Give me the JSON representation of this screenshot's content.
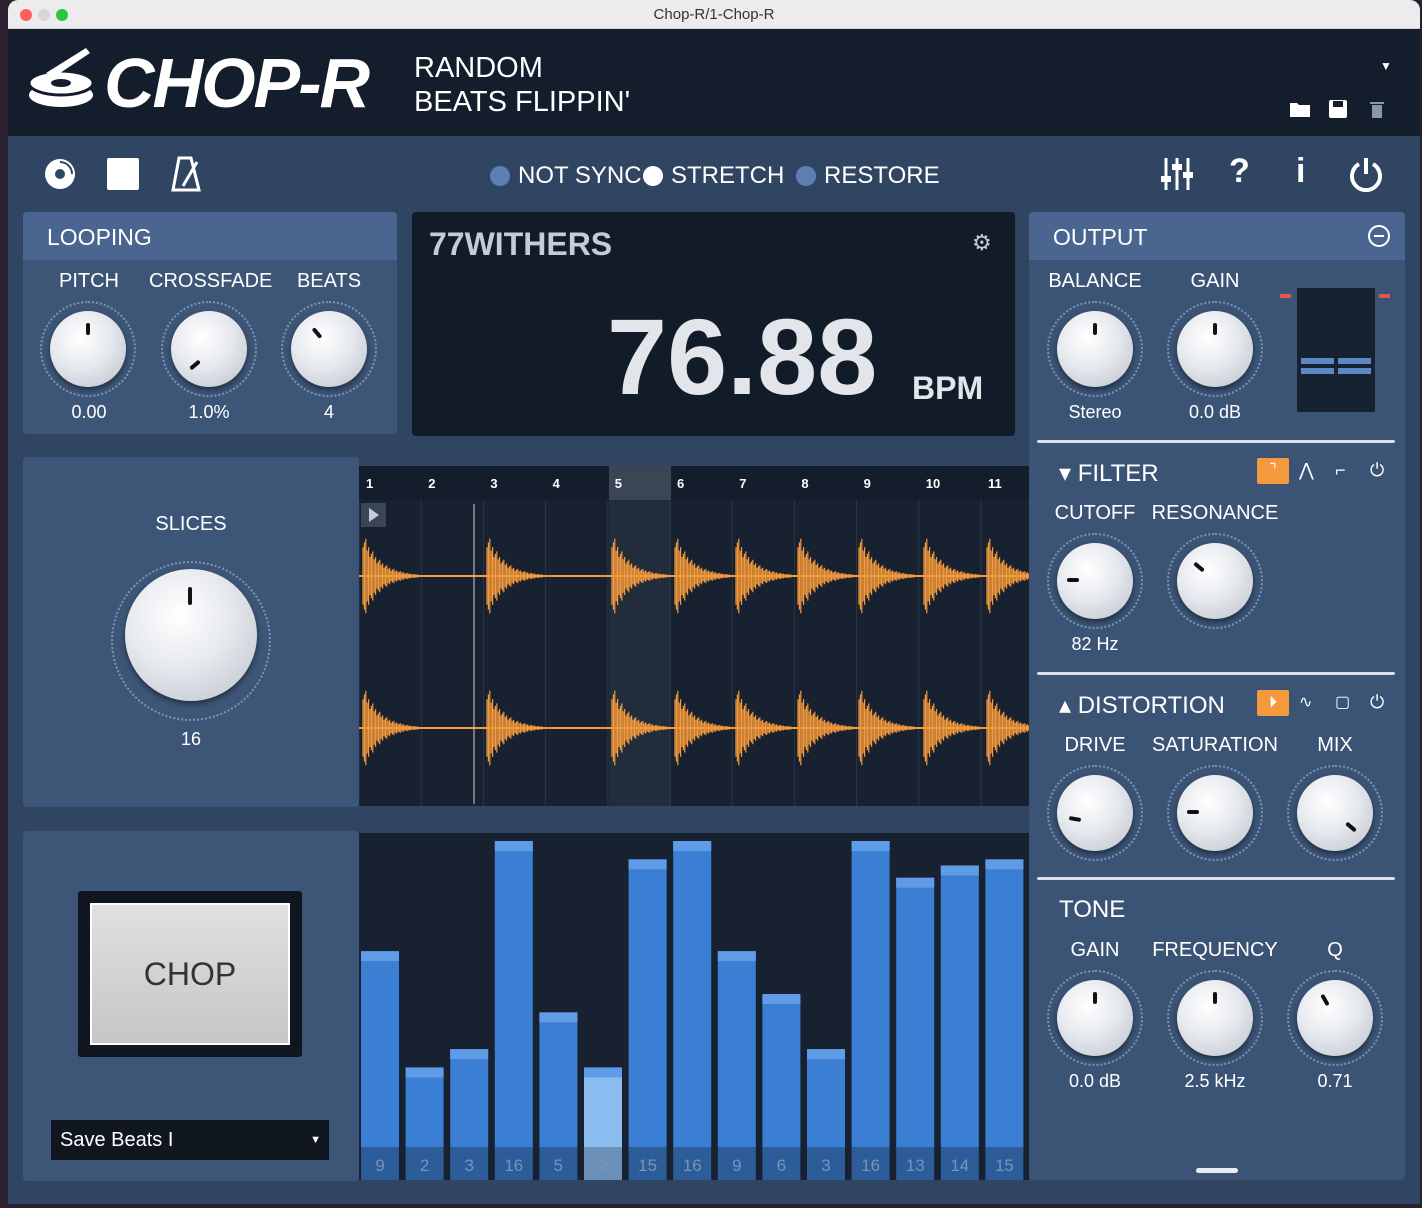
{
  "window": {
    "title": "Chop-R/1-Chop-R"
  },
  "header": {
    "logo": "CHOP-R",
    "tagline_line1": "RANDOM",
    "tagline_line2": "BEATS FLIPPIN'"
  },
  "toolbar": {
    "sync_options": [
      {
        "label": "NOT SYNC",
        "selected": false
      },
      {
        "label": "STRETCH",
        "selected": true
      },
      {
        "label": "RESTORE",
        "selected": false
      }
    ]
  },
  "looping": {
    "title": "LOOPING",
    "knobs": [
      {
        "label": "PITCH",
        "value": "0.00"
      },
      {
        "label": "CROSSFADE",
        "value": "1.0%"
      },
      {
        "label": "BEATS",
        "value": "4"
      }
    ]
  },
  "display": {
    "name": "77WITHERS",
    "bpm": "76.88",
    "bpm_unit": "BPM"
  },
  "slices": {
    "label": "SLICES",
    "value": "16"
  },
  "waveform": {
    "beat_labels": [
      "1",
      "2",
      "3",
      "4",
      "5",
      "6",
      "7",
      "8",
      "9",
      "10",
      "11"
    ],
    "selected_beat": "5"
  },
  "chop": {
    "button_label": "CHOP",
    "preset": "Save Beats I"
  },
  "sequencer": {
    "slice_labels": [
      "9",
      "2",
      "3",
      "16",
      "5",
      "2",
      "15",
      "16",
      "9",
      "6",
      "3",
      "16",
      "13",
      "14",
      "15"
    ],
    "levels": [
      0.64,
      0.26,
      0.32,
      1.0,
      0.44,
      0.26,
      0.94,
      1.0,
      0.64,
      0.5,
      0.32,
      1.0,
      0.88,
      0.92,
      0.94
    ],
    "highlighted_index": 5
  },
  "output": {
    "title": "OUTPUT",
    "knobs": [
      {
        "label": "BALANCE",
        "value": "Stereo"
      },
      {
        "label": "GAIN",
        "value": "0.0 dB"
      }
    ]
  },
  "filter": {
    "title": "FILTER",
    "knobs": [
      {
        "label": "CUTOFF",
        "value": "82 Hz"
      },
      {
        "label": "RESONANCE",
        "value": ""
      }
    ]
  },
  "distortion": {
    "title": "DISTORTION",
    "knobs": [
      {
        "label": "DRIVE",
        "value": ""
      },
      {
        "label": "SATURATION",
        "value": ""
      },
      {
        "label": "MIX",
        "value": ""
      }
    ]
  },
  "tone": {
    "title": "TONE",
    "knobs": [
      {
        "label": "GAIN",
        "value": "0.0 dB"
      },
      {
        "label": "FREQUENCY",
        "value": "2.5 kHz"
      },
      {
        "label": "Q",
        "value": "0.71"
      }
    ]
  },
  "colors": {
    "accent": "#f59a3c",
    "panel": "#3d5677",
    "bar": "#3b7fd4",
    "bar_highlight": "#8bbdf0"
  }
}
